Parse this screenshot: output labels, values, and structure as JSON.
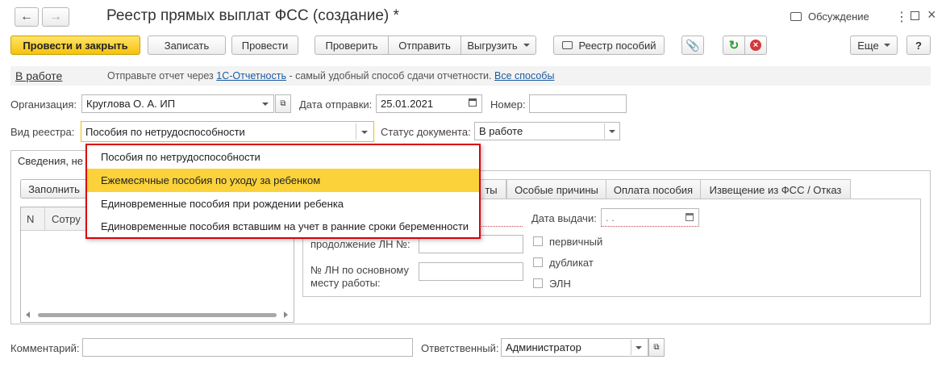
{
  "window": {
    "title": "Реестр прямых выплат ФСС (создание) *",
    "discussion": "Обсуждение"
  },
  "toolbar": {
    "post_close": "Провести и закрыть",
    "save": "Записать",
    "post": "Провести",
    "check": "Проверить",
    "send": "Отправить",
    "export": "Выгрузить",
    "benefits_registry": "Реестр пособий",
    "more": "Еще",
    "help": "?"
  },
  "status_bar": {
    "state": "В работе",
    "text_before": "Отправьте отчет через ",
    "link1": "1С-Отчетность",
    "text_after": " - самый удобный способ сдачи отчетности. ",
    "link2": "Все способы"
  },
  "form": {
    "org_label": "Организация:",
    "org_value": "Круглова О. А. ИП",
    "send_date_label": "Дата отправки:",
    "send_date_value": "25.01.2021",
    "number_label": "Номер:",
    "number_value": "",
    "registry_type_label": "Вид реестра:",
    "registry_type_value": "Пособия по нетрудоспособности",
    "doc_status_label": "Статус документа:",
    "doc_status_value": "В работе"
  },
  "dropdown": {
    "options": [
      "Пособия по нетрудоспособности",
      "Ежемесячные пособия по уходу за ребенком",
      "Единовременные пособия при рождении ребенка",
      "Единовременные пособия вставшим на учет в ранние сроки беременности"
    ],
    "highlighted_index": 1
  },
  "tabs": {
    "main_tab": "Сведения, не",
    "fill_button": "Заполнить",
    "inner_tabs": [
      "ты",
      "Особые причины",
      "Оплата пособия",
      "Извещение из ФСС / Отказ"
    ]
  },
  "table": {
    "col_n": "N",
    "col_employee": "Сотру"
  },
  "details": {
    "continuation_label": "продолжение ЛН №:",
    "main_job_label_1": "№ ЛН по основному",
    "main_job_label_2": "месту работы:",
    "issue_date_label": "Дата выдачи:",
    "issue_date_value": " .  .",
    "primary": "первичный",
    "duplicate": "дубликат",
    "eln": "ЭЛН"
  },
  "footer": {
    "comment_label": "Комментарий:",
    "comment_value": "",
    "responsible_label": "Ответственный:",
    "responsible_value": "Администратор"
  },
  "colors": {
    "primary_button": "#f6c20c",
    "dropdown_highlight": "#fbd23a",
    "dropdown_border": "#d9000a",
    "link": "#1a5a9e",
    "ok_green": "#2e9b2e",
    "close_red": "#d23a3a"
  }
}
